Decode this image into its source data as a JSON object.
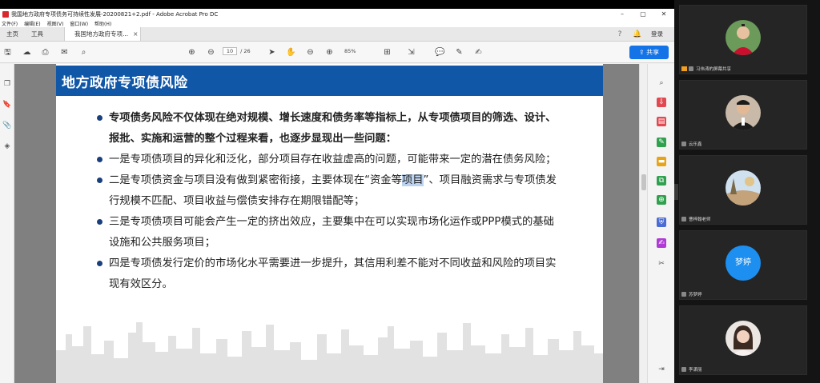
{
  "window": {
    "title": "我国地方政府专项债务可持续性发展-20200821+2.pdf - Adobe Acrobat Pro DC",
    "minimize": "–",
    "maximize": "▢",
    "close": "✕"
  },
  "menu": [
    "文件(F)",
    "编辑(E)",
    "视图(V)",
    "窗口(W)",
    "帮助(H)"
  ],
  "tabs": {
    "home": "主页",
    "tools": "工具",
    "document": "我国地方政府专项...",
    "document_close": "×"
  },
  "account": {
    "login": "登录"
  },
  "toolbar": {
    "current_page": "10",
    "total_pages": "/ 26",
    "zoom": "85%",
    "share": "共享"
  },
  "slide": {
    "title": "地方政府专项债风险",
    "bullets": [
      {
        "text": "专项债务风险不仅体现在绝对规模、增长速度和债务率等指标上，从专项债项目的筛选、设计、报批、实施和运营的整个过程来看，也逐步显现出一些问题：",
        "bold": true
      },
      {
        "text": "一是专项债项目的异化和泛化，部分项目存在收益虚高的问题，可能带来一定的潜在债务风险；",
        "bold": false
      },
      {
        "text_before": "二是专项债资金与项目没有做到紧密衔接，主要体现在“资金等",
        "text_highlight": "项目",
        "text_after": "”、项目融资需求与专项债发行规模不匹配、项目收益与偿债安排存在期限错配等；",
        "bold": false
      },
      {
        "text": "三是专项债项目可能会产生一定的挤出效应，主要集中在可以实现市场化运作或PPP模式的基础设施和公共服务项目；",
        "bold": false
      },
      {
        "text": "四是专项债发行定价的市场化水平需要进一步提升，其信用利差不能对不同收益和风险的项目实现有效区分。",
        "bold": false
      }
    ]
  },
  "participants": [
    {
      "name": "习伟涛的屏幕共享",
      "avatar": "photo-male-green"
    },
    {
      "name": "云乐鑫",
      "avatar": "photo-male-suit"
    },
    {
      "name": "曹梓翰老师",
      "avatar": "photo-landscape"
    },
    {
      "name": "苏梦婷",
      "avatar_text": "梦婷"
    },
    {
      "name": "李潇丽",
      "avatar": "photo-female"
    }
  ],
  "colors": {
    "slide_header": "#1157a8",
    "share_button": "#1473e6",
    "avatar_text_bg": "#1c8ff0"
  }
}
